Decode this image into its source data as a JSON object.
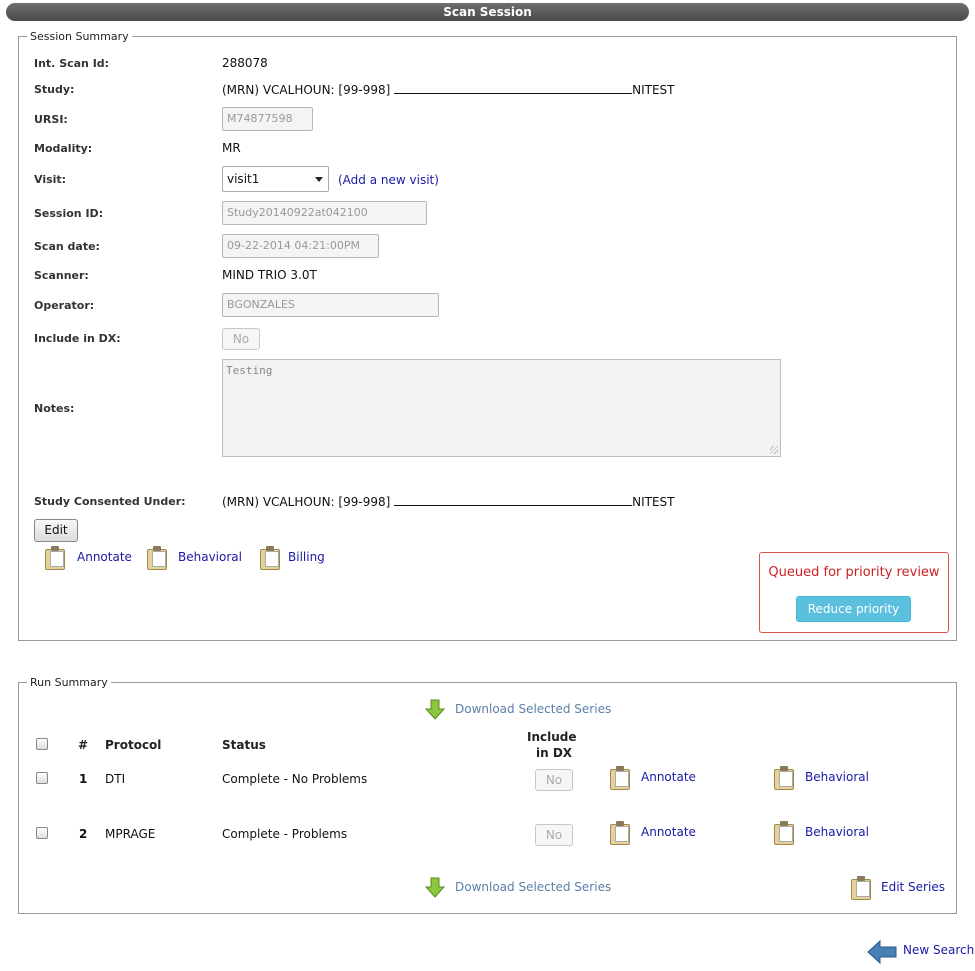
{
  "header": {
    "title": "Scan Session"
  },
  "session": {
    "legend": "Session Summary",
    "fields": {
      "int_scan_id_label": "Int. Scan Id:",
      "int_scan_id": "288078",
      "study_label": "Study:",
      "study_prefix": "(MRN) VCALHOUN: [99-998]",
      "study_suffix": "NITEST",
      "ursi_label": "URSI:",
      "ursi": "M74877598",
      "modality_label": "Modality:",
      "modality": "MR",
      "visit_label": "Visit:",
      "visit": "visit1",
      "add_visit": "(Add a new visit)",
      "session_id_label": "Session ID:",
      "session_id": "Study20140922at042100",
      "scan_date_label": "Scan date:",
      "scan_date": "09-22-2014 04:21:00PM",
      "scanner_label": "Scanner:",
      "scanner": "MIND TRIO 3.0T",
      "operator_label": "Operator:",
      "operator": "BGONZALES",
      "include_dx_label": "Include in DX:",
      "include_dx": "No",
      "notes_label": "Notes:",
      "notes": "Testing",
      "consented_label": "Study Consented Under:",
      "consented_prefix": "(MRN) VCALHOUN: [99-998]",
      "consented_suffix": "NITEST"
    },
    "edit_label": "Edit",
    "actions": [
      "Annotate",
      "Behavioral",
      "Billing"
    ],
    "priority": {
      "message": "Queued for priority review",
      "button": "Reduce priority",
      "color": "#d9534f",
      "button_color": "#5bc0de"
    }
  },
  "runs": {
    "legend": "Run Summary",
    "download_label": "Download Selected Series",
    "columns": {
      "num": "#",
      "protocol": "Protocol",
      "status": "Status",
      "include_line1": "Include",
      "include_line2": "in DX"
    },
    "rows": [
      {
        "num": "1",
        "protocol": "DTI",
        "status": "Complete - No Problems",
        "include": "No",
        "annotate": "Annotate",
        "behavioral": "Behavioral"
      },
      {
        "num": "2",
        "protocol": "MPRAGE",
        "status": "Complete - Problems",
        "include": "No",
        "annotate": "Annotate",
        "behavioral": "Behavioral"
      }
    ],
    "edit_series": "Edit Series"
  },
  "footer": {
    "new_search": "New Search"
  }
}
